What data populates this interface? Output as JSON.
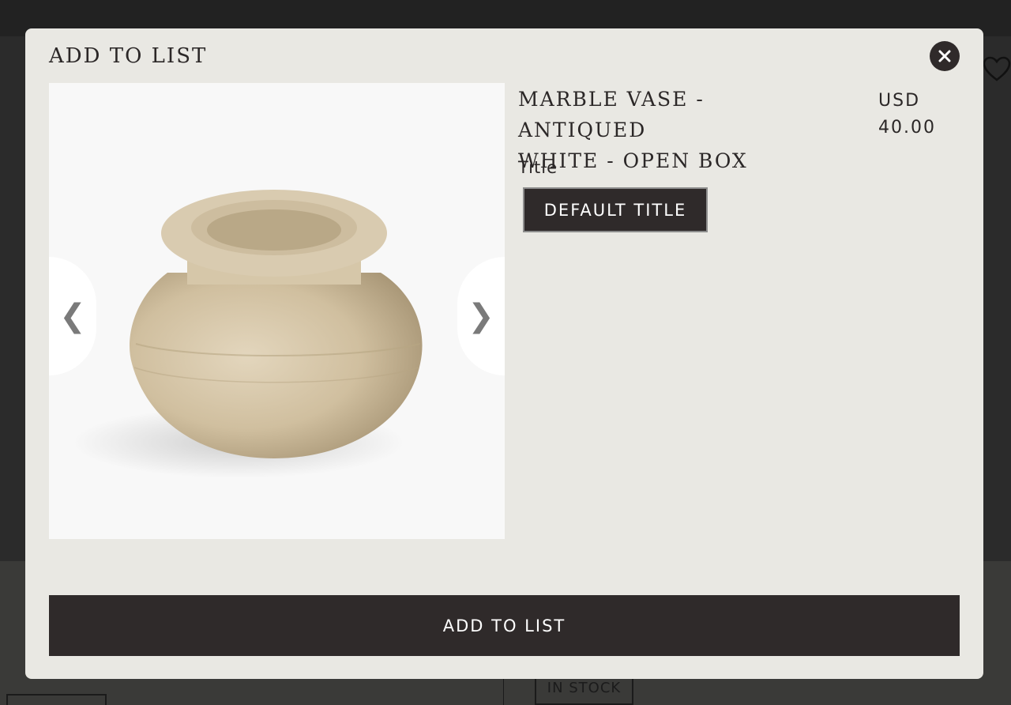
{
  "modal": {
    "title": "ADD TO LIST",
    "close_icon": "close-icon"
  },
  "product": {
    "name_line1": "MARBLE VASE - ANTIQUED",
    "name_line2": "WHITE - OPEN BOX",
    "currency": "USD",
    "price": "40.00",
    "option_label": "Title",
    "option_value": "DEFAULT TITLE"
  },
  "gallery": {
    "prev_icon": "chevron-left-icon",
    "next_icon": "chevron-right-icon",
    "prev_glyph": "❮",
    "next_glyph": "❯"
  },
  "actions": {
    "add_to_list_label": "ADD TO LIST"
  },
  "background": {
    "stock_label": "IN STOCK",
    "wishlist_icon": "heart-icon"
  },
  "colors": {
    "modal_bg": "#e9e8e3",
    "button_dark": "#2f2a2a",
    "text": "#2b2727"
  }
}
